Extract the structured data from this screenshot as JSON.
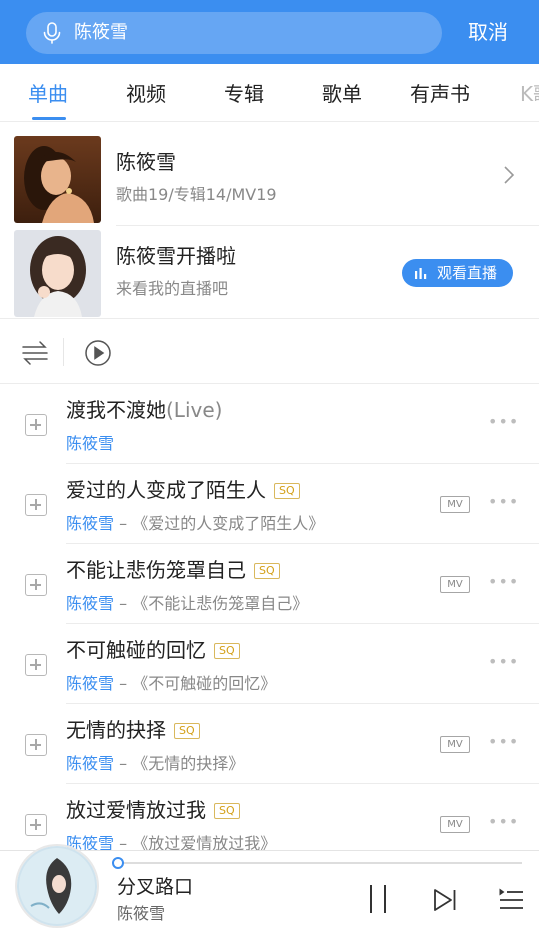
{
  "search": {
    "query": "陈筱雪",
    "cancel_label": "取消"
  },
  "tabs": [
    {
      "label": "单曲",
      "active": true
    },
    {
      "label": "视频",
      "active": false
    },
    {
      "label": "专辑",
      "active": false
    },
    {
      "label": "歌单",
      "active": false
    },
    {
      "label": "有声书",
      "active": false
    },
    {
      "label": "K歌",
      "active": false
    }
  ],
  "artist_card": {
    "name": "陈筱雪",
    "stats": "歌曲19/专辑14/MV19"
  },
  "live_card": {
    "title": "陈筱雪开播啦",
    "subtitle": "来看我的直播吧",
    "button_label": "观看直播"
  },
  "songs": [
    {
      "title": "渡我不渡她",
      "suffix": "(Live)",
      "sq": false,
      "sq_label": "SQ",
      "artist": "陈筱雪",
      "album": "",
      "mv": false,
      "mv_label": "MV"
    },
    {
      "title": "爱过的人变成了陌生人",
      "suffix": "",
      "sq": true,
      "sq_label": "SQ",
      "artist": "陈筱雪",
      "album": " – 《爱过的人变成了陌生人》",
      "mv": true,
      "mv_label": "MV"
    },
    {
      "title": "不能让悲伤笼罩自己",
      "suffix": "",
      "sq": true,
      "sq_label": "SQ",
      "artist": "陈筱雪",
      "album": " – 《不能让悲伤笼罩自己》",
      "mv": true,
      "mv_label": "MV"
    },
    {
      "title": "不可触碰的回忆",
      "suffix": "",
      "sq": true,
      "sq_label": "SQ",
      "artist": "陈筱雪",
      "album": " – 《不可触碰的回忆》",
      "mv": false,
      "mv_label": "MV"
    },
    {
      "title": "无情的抉择",
      "suffix": "",
      "sq": true,
      "sq_label": "SQ",
      "artist": "陈筱雪",
      "album": " – 《无情的抉择》",
      "mv": true,
      "mv_label": "MV"
    },
    {
      "title": "放过爱情放过我",
      "suffix": "",
      "sq": true,
      "sq_label": "SQ",
      "artist": "陈筱雪",
      "album": " – 《放过爱情放过我》",
      "mv": true,
      "mv_label": "MV"
    }
  ],
  "player": {
    "title": "分叉路口",
    "artist": "陈筱雪",
    "progress": 0.0
  },
  "colors": {
    "accent": "#3b8ef0",
    "sq_gold": "#d4a017"
  }
}
